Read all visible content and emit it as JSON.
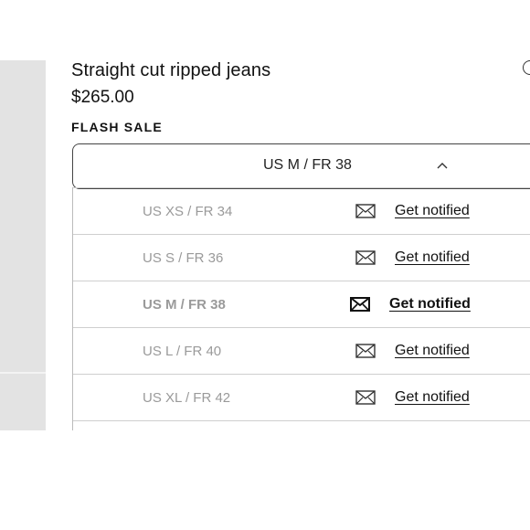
{
  "product": {
    "title": "Straight cut ripped jeans",
    "price": "$265.00",
    "badge": "FLASH SALE"
  },
  "size_selector": {
    "selected": "US M / FR 38",
    "expanded": true
  },
  "size_options": [
    {
      "label": "US XS / FR 34",
      "action": "Get notified",
      "selected": false
    },
    {
      "label": "US S / FR 36",
      "action": "Get notified",
      "selected": false
    },
    {
      "label": "US M / FR 38",
      "action": "Get notified",
      "selected": true
    },
    {
      "label": "US L / FR 40",
      "action": "Get notified",
      "selected": false
    },
    {
      "label": "US XL / FR 42",
      "action": "Get notified",
      "selected": false
    }
  ],
  "icons": {
    "notify": "envelope-icon",
    "selector": "chevron-up-icon",
    "wishlist": "heart-icon"
  },
  "colors": {
    "text": "#111111",
    "muted": "#9a9a9a",
    "panel": "#e3e3e3"
  }
}
